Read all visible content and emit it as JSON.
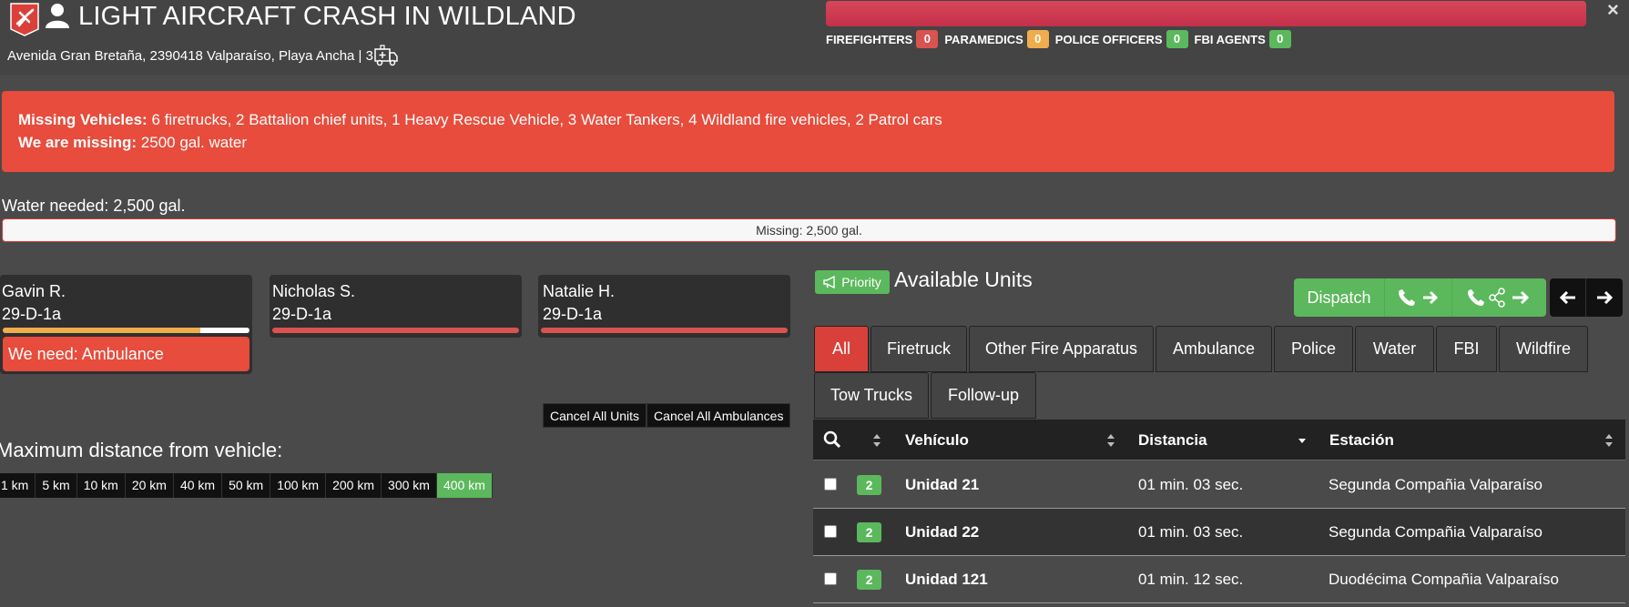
{
  "header": {
    "title": "LIGHT AIRCRAFT CRASH IN WILDLAND",
    "address": "Avenida Gran Bretaña, 2390418 Valparaíso, Playa Ancha | 3",
    "personnel": [
      {
        "label": "FIREFIGHTERS",
        "count": "0",
        "color": "#d9534f"
      },
      {
        "label": "PARAMEDICS",
        "count": "0",
        "color": "#f0ad4e"
      },
      {
        "label": "POLICE OFFICERS",
        "count": "0",
        "color": "#5cb85c"
      },
      {
        "label": "FBI AGENTS",
        "count": "0",
        "color": "#5cb85c"
      }
    ],
    "close_glyph": "×"
  },
  "alert": {
    "missing_vehicles_label": "Missing Vehicles:",
    "missing_vehicles_value": " 6 firetrucks, 2 Battalion chief units, 1 Heavy Rescue Vehicle, 3 Water Tankers, 4 Wildland fire vehicles, 2 Patrol cars",
    "we_are_missing_label": "We are missing:",
    "we_are_missing_value": " 2500 gal. water"
  },
  "water": {
    "needed": "Water needed: 2,500 gal.",
    "missing": "Missing: 2,500 gal."
  },
  "patients": [
    {
      "name": "Gavin R.",
      "code": "29-D-1a",
      "need": "We need: Ambulance",
      "fill_fraction": 0.8
    },
    {
      "name": "Nicholas S.",
      "code": "29-D-1a"
    },
    {
      "name": "Natalie H.",
      "code": "29-D-1a"
    }
  ],
  "cancel": {
    "all_units": "Cancel All Units",
    "all_ambulances": "Cancel All Ambulances"
  },
  "distance": {
    "title": "Maximum distance from vehicle:",
    "options": [
      "1 km",
      "5 km",
      "10 km",
      "20 km",
      "40 km",
      "50 km",
      "100 km",
      "200 km",
      "300 km",
      "400 km"
    ],
    "selected": "400 km"
  },
  "units": {
    "priority_label": "Priority",
    "title": "Available Units",
    "dispatch_label": "Dispatch",
    "tabs": [
      "All",
      "Firetruck",
      "Other Fire Apparatus",
      "Ambulance",
      "Police",
      "Water",
      "FBI",
      "Wildfire",
      "Tow Trucks",
      "Follow-up"
    ],
    "active_tab": "All",
    "columns": {
      "vehicle": "Vehículo",
      "distance": "Distancia",
      "station": "Estación"
    },
    "rows": [
      {
        "badge": "2",
        "vehicle": "Unidad 21",
        "distance": "01 min. 03 sec.",
        "station": "Segunda Compañia Valparaíso"
      },
      {
        "badge": "2",
        "vehicle": "Unidad 22",
        "distance": "01 min. 03 sec.",
        "station": "Segunda Compañia Valparaíso"
      },
      {
        "badge": "2",
        "vehicle": "Unidad 121",
        "distance": "01 min. 12 sec.",
        "station": "Duodécima Compañia Valparaíso"
      }
    ]
  },
  "colors": {
    "danger": "#e74c3c",
    "success": "#5cb85c",
    "warning": "#f0ad4e"
  }
}
